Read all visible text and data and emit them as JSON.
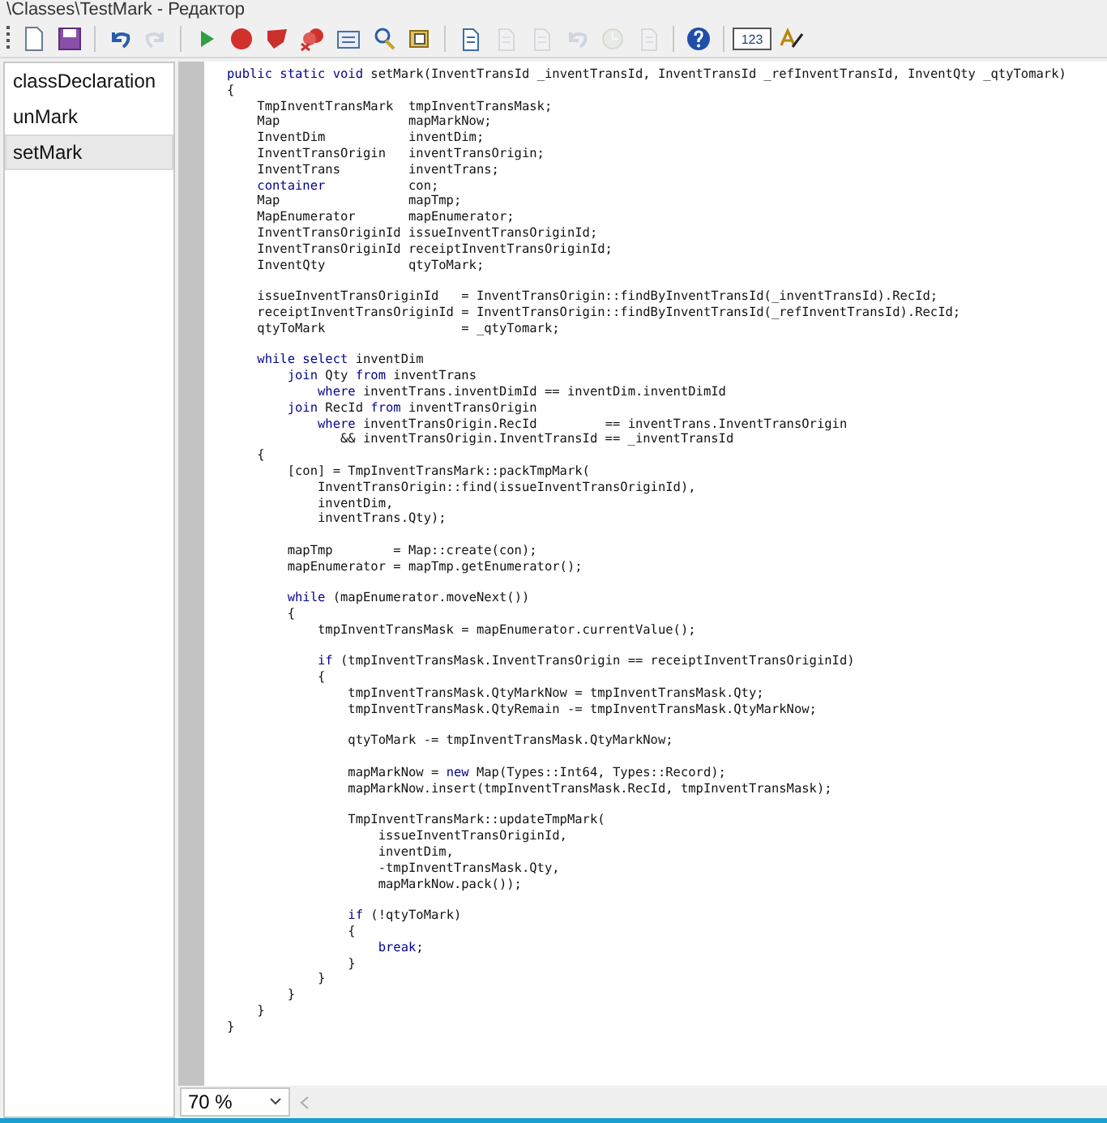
{
  "window": {
    "title": "\\Classes\\TestMark - Редактор"
  },
  "toolbar": {
    "buttons": [
      {
        "kind": "new",
        "disabled": false
      },
      {
        "kind": "save",
        "disabled": false
      },
      {
        "kind": "sep"
      },
      {
        "kind": "undo",
        "disabled": false
      },
      {
        "kind": "redo",
        "disabled": true
      },
      {
        "kind": "sep"
      },
      {
        "kind": "run",
        "disabled": false
      },
      {
        "kind": "record",
        "disabled": false
      },
      {
        "kind": "shield",
        "disabled": false
      },
      {
        "kind": "clear",
        "disabled": false
      },
      {
        "kind": "list",
        "disabled": false
      },
      {
        "kind": "find",
        "disabled": false
      },
      {
        "kind": "script",
        "disabled": false
      },
      {
        "kind": "sep"
      },
      {
        "kind": "doc",
        "disabled": false
      },
      {
        "kind": "doc",
        "disabled": true
      },
      {
        "kind": "doc",
        "disabled": true
      },
      {
        "kind": "undo",
        "disabled": true
      },
      {
        "kind": "clock",
        "disabled": true
      },
      {
        "kind": "doc",
        "disabled": true
      },
      {
        "kind": "sep"
      },
      {
        "kind": "help",
        "disabled": false
      },
      {
        "kind": "sep"
      },
      {
        "kind": "label",
        "label": "123",
        "disabled": false
      },
      {
        "kind": "ab",
        "disabled": false
      }
    ]
  },
  "sidebar": {
    "items": [
      {
        "label": "classDeclaration",
        "selected": false
      },
      {
        "label": "unMark",
        "selected": false
      },
      {
        "label": "setMark",
        "selected": true
      }
    ]
  },
  "code": {
    "blocks": [
      {
        "lines": [
          "**public static void** setMark(InventTransId _inventTransId, InventTransId _refInventTransId, InventQty _qtyTomark)",
          "{",
          "    TmpInventTransMark  tmpInventTransMask;",
          "    Map                 mapMarkNow;",
          "    InventDim           inventDim;",
          "    InventTransOrigin   inventTransOrigin;",
          "    InventTrans         inventTrans;",
          "    **container**           con;",
          "    Map                 mapTmp;",
          "    MapEnumerator       mapEnumerator;",
          "    InventTransOriginId issueInventTransOriginId;",
          "    InventTransOriginId receiptInventTransOriginId;",
          "    InventQty           qtyToMark;"
        ]
      },
      {
        "lines": [
          "    issueInventTransOriginId   = InventTransOrigin::findByInventTransId(_inventTransId).RecId;",
          "    receiptInventTransOriginId = InventTransOrigin::findByInventTransId(_refInventTransId).RecId;",
          "    qtyToMark                  = _qtyTomark;"
        ]
      },
      {
        "lines": [
          "    **while select** inventDim",
          "        **join** Qty **from** inventTrans",
          "            **where** inventTrans.inventDimId == inventDim.inventDimId",
          "        **join** RecId **from** inventTransOrigin",
          "            **where** inventTransOrigin.RecId         == inventTrans.InventTransOrigin",
          "               && inventTransOrigin.InventTransId == _inventTransId",
          "    {",
          "        [con] = TmpInventTransMark::packTmpMark(",
          "            InventTransOrigin::find(issueInventTransOriginId),",
          "            inventDim,",
          "            inventTrans.Qty);"
        ]
      },
      {
        "lines": [
          "        mapTmp        = Map::create(con);",
          "        mapEnumerator = mapTmp.getEnumerator();"
        ]
      },
      {
        "lines": [
          "        **while** (mapEnumerator.moveNext())",
          "        {",
          "            tmpInventTransMask = mapEnumerator.currentValue();"
        ]
      },
      {
        "lines": [
          "            **if** (tmpInventTransMask.InventTransOrigin == receiptInventTransOriginId)",
          "            {",
          "                tmpInventTransMask.QtyMarkNow = tmpInventTransMask.Qty;",
          "                tmpInventTransMask.QtyRemain -= tmpInventTransMask.QtyMarkNow;"
        ]
      },
      {
        "lines": [
          "                qtyToMark -= tmpInventTransMask.QtyMarkNow;"
        ]
      },
      {
        "lines": [
          "                mapMarkNow = **new** Map(Types::Int64, Types::Record);",
          "                mapMarkNow.insert(tmpInventTransMask.RecId, tmpInventTransMask);"
        ]
      },
      {
        "lines": [
          "                TmpInventTransMark::updateTmpMark(",
          "                    issueInventTransOriginId,",
          "                    inventDim,",
          "                    -tmpInventTransMask.Qty,",
          "                    mapMarkNow.pack());"
        ]
      },
      {
        "lines": [
          "                **if** (!qtyToMark)",
          "                {",
          "                    **break**;",
          "                }",
          "            }",
          "        }",
          "    }",
          "}"
        ]
      }
    ]
  },
  "status_bar": {
    "zoom": "70 %"
  }
}
